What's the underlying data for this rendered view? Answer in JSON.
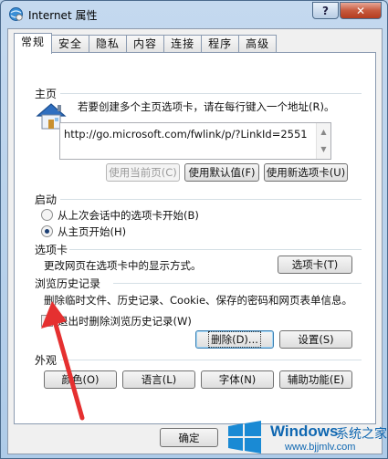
{
  "window": {
    "title": "Internet 属性",
    "help_glyph": "?",
    "close_glyph": "✕"
  },
  "tabs": [
    "常规",
    "安全",
    "隐私",
    "内容",
    "连接",
    "程序",
    "高级"
  ],
  "home": {
    "label": "主页",
    "instruction": "若要创建多个主页选项卡，请在每行键入一个地址(R)。",
    "url": "http://go.microsoft.com/fwlink/p/?LinkId=2551",
    "buttons": [
      "使用当前页(C)",
      "使用默认值(F)",
      "使用新选项卡(U)"
    ]
  },
  "startup": {
    "label": "启动",
    "options": [
      "从上次会话中的选项卡开始(B)",
      "从主页开始(H)"
    ],
    "selected_index": 1
  },
  "tabs_section": {
    "label": "选项卡",
    "description": "更改网页在选项卡中的显示方式。",
    "button": "选项卡(T)"
  },
  "history": {
    "label": "浏览历史记录",
    "description": "删除临时文件、历史记录、Cookie、保存的密码和网页表单信息。",
    "checkbox_label": "退出时删除浏览历史记录(W)",
    "checkbox_checked": false,
    "delete_button": "删除(D)...",
    "settings_button": "设置(S)"
  },
  "appearance": {
    "label": "外观",
    "buttons": [
      "颜色(O)",
      "语言(L)",
      "字体(N)",
      "辅助功能(E)"
    ]
  },
  "footer": {
    "ok_button": "确定"
  },
  "watermark": {
    "brand": "Windows",
    "brand_cn": "系统之家",
    "url": "www.bjjmlv.com"
  },
  "colors": {
    "arrow": "#e53030",
    "focus": "#3c7fb1",
    "watermark": "#0f67b1"
  }
}
